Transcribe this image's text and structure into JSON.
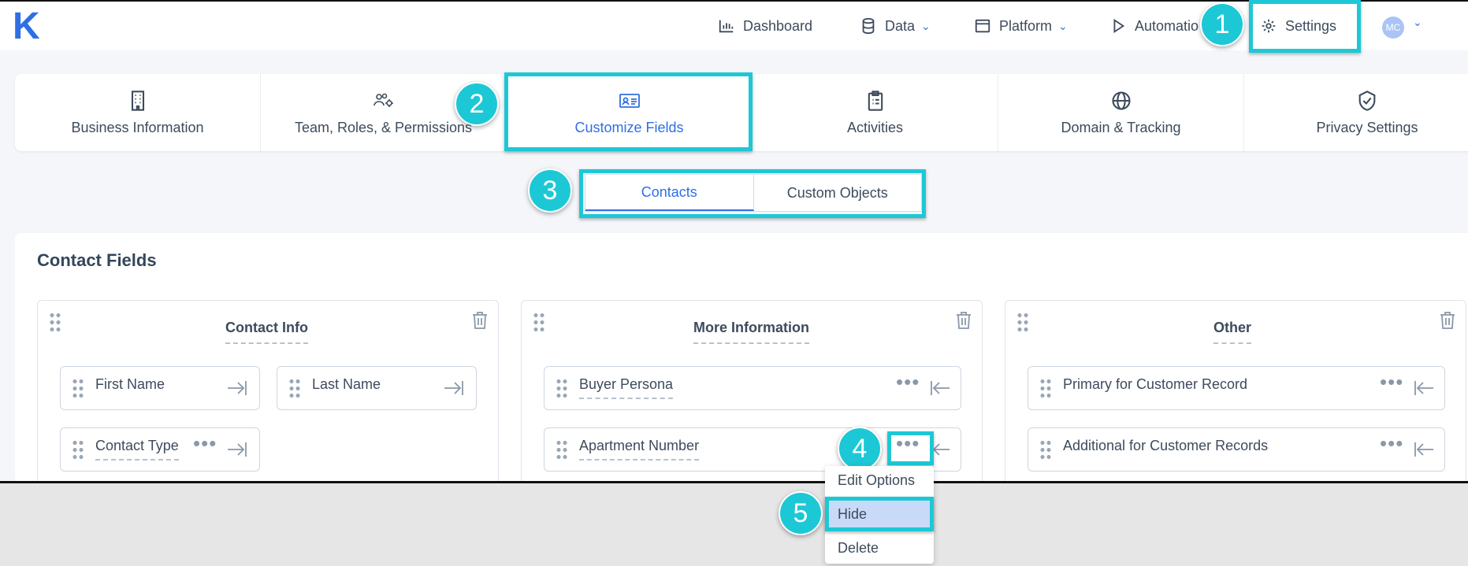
{
  "logo": "K",
  "nav": {
    "dashboard": "Dashboard",
    "data": "Data",
    "platform": "Platform",
    "automation": "Automatio",
    "settings": "Settings",
    "avatar_initials": "MC"
  },
  "tabs": [
    {
      "label": "Business Information",
      "icon": "building-icon"
    },
    {
      "label": "Team, Roles, & Permissions",
      "icon": "users-gear-icon"
    },
    {
      "label": "Customize Fields",
      "icon": "id-card-icon"
    },
    {
      "label": "Activities",
      "icon": "clipboard-icon"
    },
    {
      "label": "Domain & Tracking",
      "icon": "globe-icon"
    },
    {
      "label": "Privacy Settings",
      "icon": "shield-check-icon"
    }
  ],
  "segments": {
    "contacts": "Contacts",
    "custom_objects": "Custom Objects"
  },
  "section_title": "Contact Fields",
  "groups": [
    {
      "title": "Contact Info",
      "fields": [
        "First Name",
        "Last Name",
        "Contact Type"
      ]
    },
    {
      "title": "More Information",
      "fields": [
        "Buyer Persona",
        "Apartment Number"
      ]
    },
    {
      "title": "Other",
      "fields": [
        "Primary for Customer Record",
        "Additional for Customer Records"
      ]
    }
  ],
  "context_menu": {
    "edit": "Edit Options",
    "hide": "Hide",
    "delete": "Delete"
  },
  "steps": [
    "1",
    "2",
    "3",
    "4",
    "5"
  ],
  "colors": {
    "accent": "#2f6fe4",
    "highlight": "#1dc8d6",
    "menu_selected": "#c9daf8"
  }
}
